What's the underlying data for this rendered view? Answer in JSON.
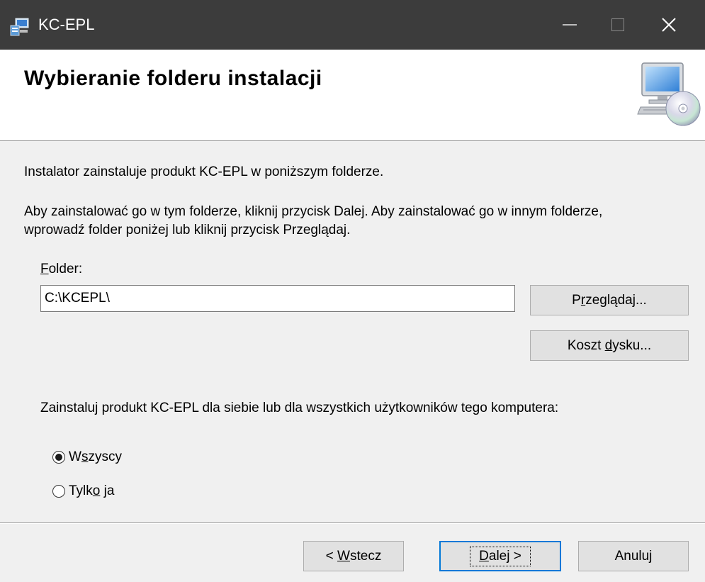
{
  "window": {
    "title": "KC-EPL",
    "app_icon": "installer-icon"
  },
  "header": {
    "title": "Wybieranie folderu instalacji",
    "icon": "computer-cd-icon"
  },
  "body": {
    "intro_line": "Instalator zainstaluje produkt KC-EPL w poniższym folderze.",
    "instructions_line1": "Aby zainstalować go w tym folderze, kliknij przycisk Dalej. Aby zainstalować go w innym folderze,",
    "instructions_line2": "wprowadź folder poniżej lub kliknij przycisk Przeglądaj.",
    "folder_label_accel": "F",
    "folder_label_rest": "older:",
    "folder_value": "C:\\KCEPL\\",
    "browse_pre": "P",
    "browse_accel": "r",
    "browse_post": "zeglądaj...",
    "diskcost_pre": "Koszt ",
    "diskcost_accel": "d",
    "diskcost_post": "ysku...",
    "scope_label": "Zainstaluj produkt KC-EPL dla siebie lub dla wszystkich użytkowników tego komputera:",
    "radio_all": {
      "pre": "W",
      "accel": "s",
      "post": "zyscy",
      "selected": true
    },
    "radio_me": {
      "pre": "Tylk",
      "accel": "o",
      "post": " ja",
      "selected": false
    }
  },
  "footer": {
    "back_pre": "< ",
    "back_accel": "W",
    "back_post": "stecz",
    "next_accel": "D",
    "next_post": "alej >",
    "cancel": "Anuluj"
  },
  "colors": {
    "titlebar": "#3c3c3c",
    "focus_border": "#0078d7",
    "button_face": "#e1e1e1"
  }
}
